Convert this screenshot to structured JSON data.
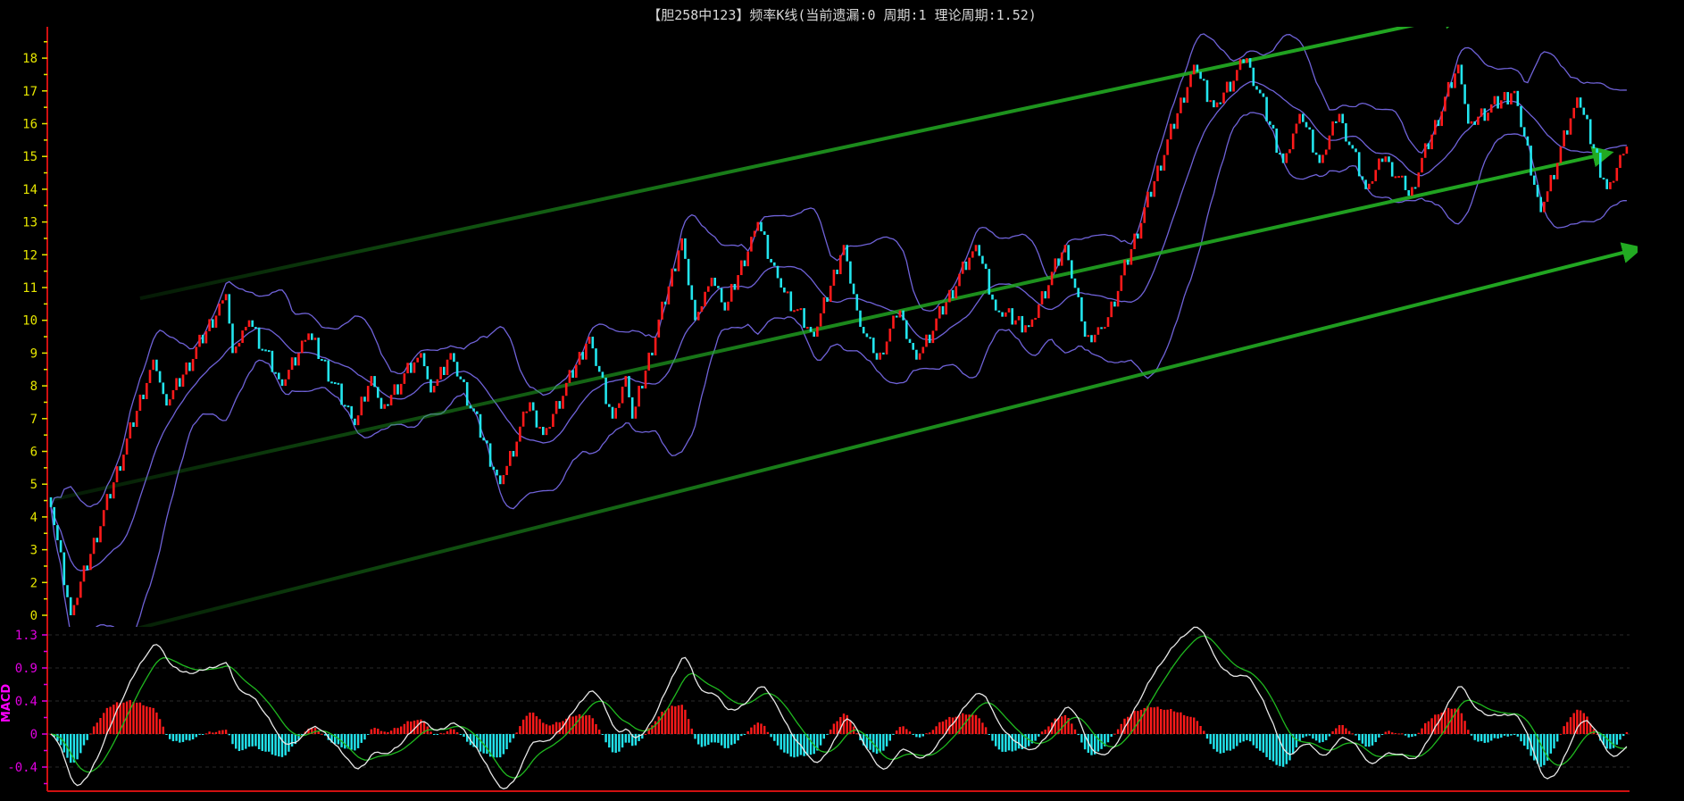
{
  "title": "【胆258中123】频率K线(当前遗漏:0 周期:1 理论周期:1.52)",
  "macd_label": "MACD",
  "colors": {
    "up": "#ff1a1a",
    "down": "#22e5ee",
    "band": "#6f62d8",
    "trend": "#22aa22",
    "dif": "#e8e8e8",
    "dea": "#1fb81f",
    "axis": "#d01010",
    "ytick": "#e6e600",
    "mtick": "#e000e0"
  },
  "chart_data": [
    {
      "type": "candlestick",
      "title": "【胆258中123】频率K线(当前遗漏:0 周期:1 理论周期:1.52)",
      "y_tick_labels": [
        "0",
        "2",
        "3",
        "4",
        "5",
        "6",
        "7",
        "8",
        "9",
        "10",
        "11",
        "12",
        "13",
        "14",
        "15",
        "16",
        "17",
        "18"
      ],
      "ylim": [
        0.3,
        18.8
      ],
      "bar_count": 478,
      "close_waypoints": [
        [
          0,
          4.3
        ],
        [
          6,
          1
        ],
        [
          31,
          8.8
        ],
        [
          35,
          7.4
        ],
        [
          53,
          10.8
        ],
        [
          55,
          9
        ],
        [
          60,
          10
        ],
        [
          70,
          8
        ],
        [
          78,
          9.6
        ],
        [
          92,
          6.8
        ],
        [
          97,
          8.3
        ],
        [
          100,
          7.3
        ],
        [
          112,
          9
        ],
        [
          115,
          7.8
        ],
        [
          121,
          9
        ],
        [
          136,
          5
        ],
        [
          145,
          7.5
        ],
        [
          149,
          6.5
        ],
        [
          163,
          9.5
        ],
        [
          170,
          7
        ],
        [
          174,
          8.3
        ],
        [
          176,
          7
        ],
        [
          191,
          12.5
        ],
        [
          195,
          10
        ],
        [
          200,
          11.3
        ],
        [
          204,
          10.3
        ],
        [
          214,
          13
        ],
        [
          221,
          11
        ],
        [
          231,
          9.5
        ],
        [
          240,
          12.3
        ],
        [
          245,
          9.8
        ],
        [
          250,
          8.8
        ],
        [
          257,
          10.3
        ],
        [
          262,
          8.8
        ],
        [
          280,
          12.3
        ],
        [
          286,
          10.3
        ],
        [
          296,
          9.8
        ],
        [
          307,
          12.3
        ],
        [
          313,
          9.5
        ],
        [
          319,
          9.8
        ],
        [
          346,
          17.8
        ],
        [
          352,
          16.5
        ],
        [
          362,
          18
        ],
        [
          373,
          14.8
        ],
        [
          378,
          16.3
        ],
        [
          384,
          14.8
        ],
        [
          390,
          16.3
        ],
        [
          398,
          14
        ],
        [
          404,
          15
        ],
        [
          411,
          13.8
        ],
        [
          426,
          17.8
        ],
        [
          429,
          16
        ],
        [
          443,
          17
        ],
        [
          451,
          13.3
        ],
        [
          462,
          16.8
        ],
        [
          471,
          14
        ],
        [
          477,
          15.3
        ]
      ],
      "bollinger": {
        "period": 20,
        "k": 2
      },
      "trend_lines": [
        {
          "name": "upper",
          "from": [
            27,
            10.67
          ],
          "to": [
            426,
            19.3
          ]
        },
        {
          "name": "middle",
          "from": [
            1,
            4.54
          ],
          "to": [
            471,
            15.09
          ]
        },
        {
          "name": "lower",
          "from": [
            11,
            0.21
          ],
          "to": [
            480,
            12.17
          ]
        }
      ]
    },
    {
      "type": "macd",
      "label": "MACD",
      "y_tick_labels": [
        "1.3",
        "0.9",
        "0.4",
        "0",
        "-0.4"
      ],
      "params": [
        12,
        26,
        9
      ],
      "series": [
        "DIF",
        "DEA",
        "MACD histogram"
      ]
    }
  ]
}
